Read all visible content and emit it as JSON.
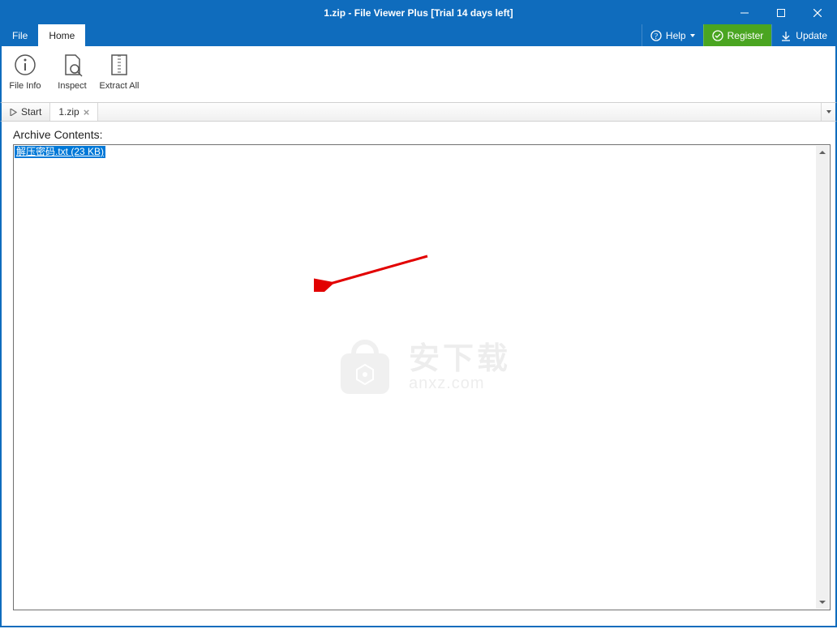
{
  "titlebar": {
    "title": "1.zip - File Viewer Plus [Trial 14 days left]"
  },
  "menubar": {
    "file": "File",
    "home": "Home",
    "help": "Help",
    "register": "Register",
    "update": "Update"
  },
  "ribbon": {
    "file_info": "File Info",
    "inspect": "Inspect",
    "extract_all": "Extract All"
  },
  "tabstrip": {
    "start": "Start",
    "tabs": [
      {
        "label": "1.zip"
      }
    ]
  },
  "content": {
    "heading": "Archive Contents:",
    "files": [
      {
        "name": "解压密码.txt",
        "size": "(23 KB)"
      }
    ]
  },
  "watermark": {
    "cn": "安下载",
    "en": "anxz.com"
  }
}
